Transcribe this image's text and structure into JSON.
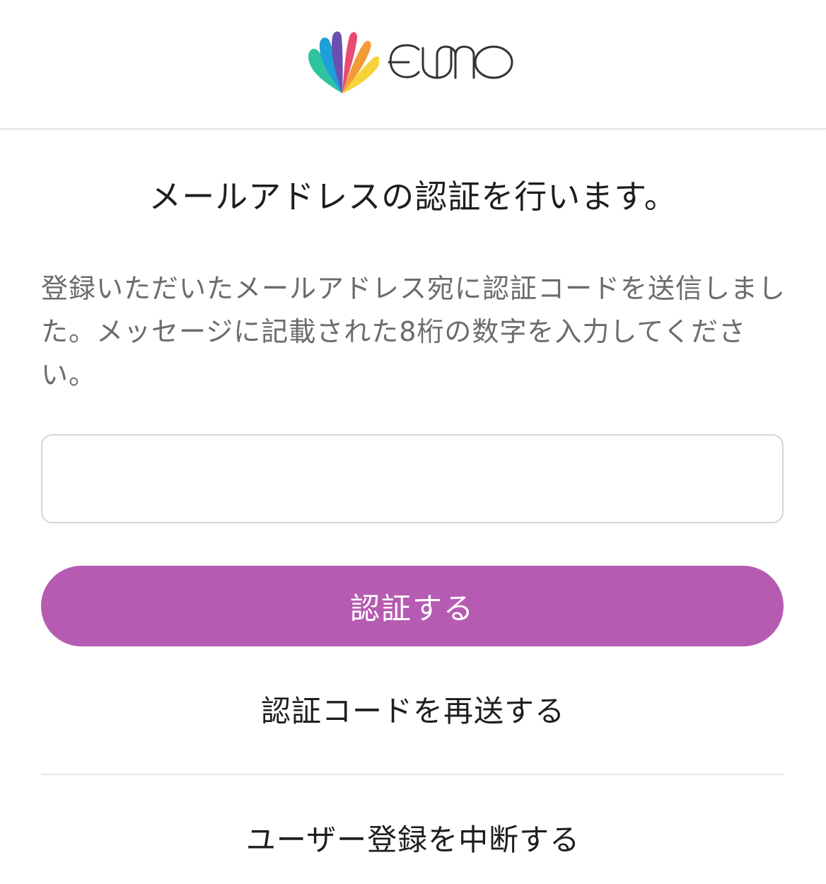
{
  "header": {
    "logo_alt": "eumo",
    "logo_text": "eumo",
    "logo_icon": "rainbow-shell-icon",
    "logo_colors": [
      "#1f9fd8",
      "#2ec4a0",
      "#6b4fb0",
      "#e84c73",
      "#f39b34",
      "#f7d23b"
    ]
  },
  "main": {
    "title": "メールアドレスの認証を行います。",
    "description": "登録いただいたメールアドレス宛に認証コードを送信しました。メッセージに記載された8桁の数字を入力してください。",
    "code_input": {
      "value": "",
      "placeholder": ""
    },
    "verify_button_label": "認証する",
    "resend_link_label": "認証コードを再送する",
    "cancel_link_label": "ユーザー登録を中断する"
  },
  "colors": {
    "accent": "#b65bb2",
    "description_text": "#6b6b70",
    "input_border": "#d5d5dc"
  }
}
